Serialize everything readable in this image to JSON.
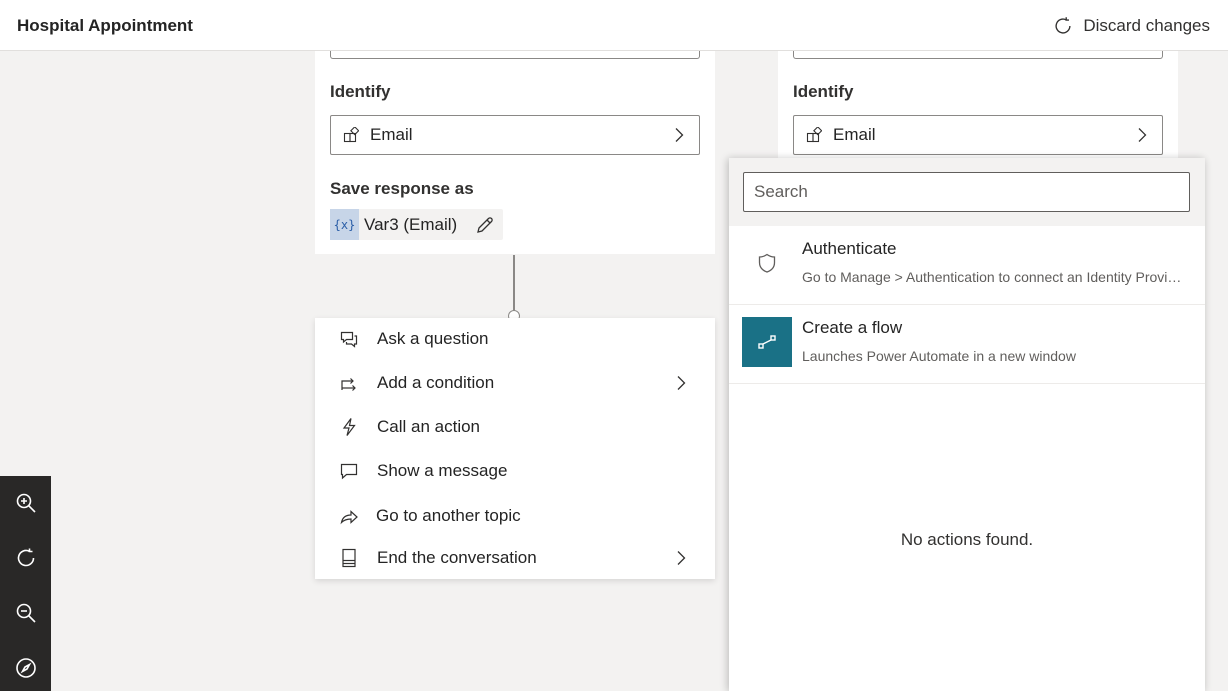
{
  "header": {
    "title": "Hospital Appointment",
    "discard_label": "Discard changes"
  },
  "left_card": {
    "identify_label": "Identify",
    "entity_value": "Email",
    "save_label": "Save response as",
    "variable": "Var3 (Email)",
    "variable_icon_text": "{x}"
  },
  "right_card": {
    "identify_label": "Identify",
    "entity_value": "Email"
  },
  "node_menu": {
    "items": [
      {
        "label": "Ask a question",
        "icon": "chat-question-icon",
        "has_submenu": false
      },
      {
        "label": "Add a condition",
        "icon": "branch-icon",
        "has_submenu": true
      },
      {
        "label": "Call an action",
        "icon": "lightning-icon",
        "has_submenu": false
      },
      {
        "label": "Show a message",
        "icon": "message-icon",
        "has_submenu": false
      },
      {
        "label": "Go to another topic",
        "icon": "share-arrow-icon",
        "has_submenu": false
      },
      {
        "label": "End the conversation",
        "icon": "end-icon",
        "has_submenu": true
      }
    ]
  },
  "action_panel": {
    "search_placeholder": "Search",
    "actions": [
      {
        "title": "Authenticate",
        "description": "Go to Manage > Authentication to connect an Identity Provider",
        "icon": "shield-icon"
      },
      {
        "title": "Create a flow",
        "description": "Launches Power Automate in a new window",
        "icon": "flow-icon",
        "icon_bg": "#1a7186"
      }
    ],
    "empty_message": "No actions found."
  },
  "zoom_controls": [
    "zoom-in-icon",
    "reset-icon",
    "zoom-out-icon",
    "compass-icon"
  ]
}
